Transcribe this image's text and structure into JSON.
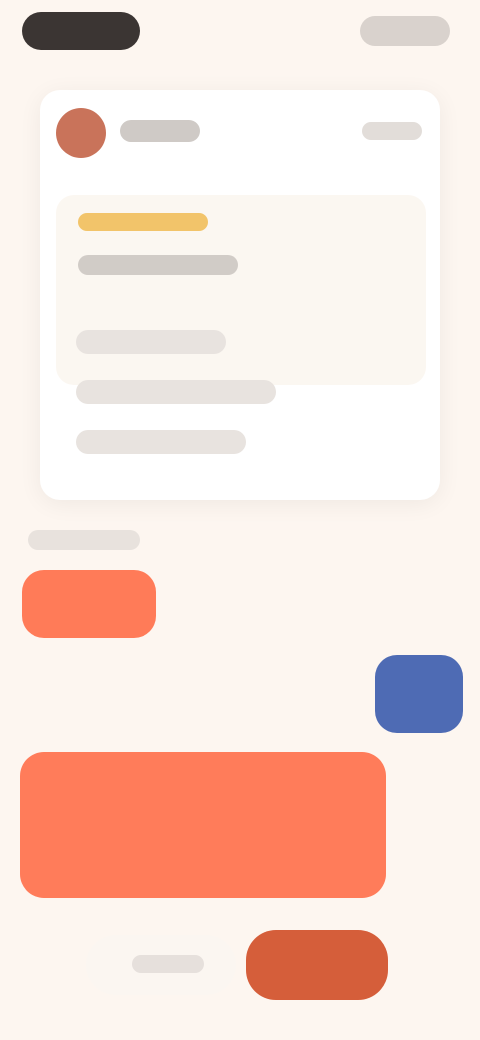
{
  "colors": {
    "background": "#fdf6f0",
    "accent_orange": "#ff7b58",
    "accent_blue": "#4e6bb4",
    "highlight_yellow": "#f2c46a",
    "button_orange": "#d55e3a",
    "dark_pill": "#3b3533"
  },
  "top_bar": {
    "left_pill": "",
    "right_button": ""
  },
  "card": {
    "avatar_icon": "avatar-icon",
    "header_title": "",
    "header_action": "",
    "highlight_title": "",
    "highlight_line": "",
    "list_items": [
      "",
      "",
      ""
    ]
  },
  "section_label": "",
  "orange_chip_label": "",
  "blue_fab_icon": "floating-action-icon",
  "panel_label": "",
  "bottom_left_field_text": "",
  "bottom_right_button_label": ""
}
